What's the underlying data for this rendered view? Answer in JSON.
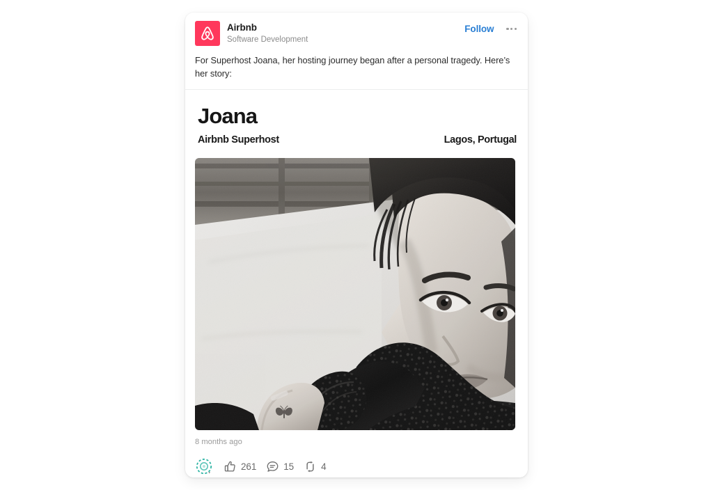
{
  "page": {
    "background_color": "#ffffff"
  },
  "post": {
    "card_background": "#ffffff",
    "header": {
      "logo_icon": "airbnb-belo-logo-icon",
      "logo_color": "#ff385c",
      "brand_name": "Airbnb",
      "brand_subtitle": "Software Development",
      "follow_label": "Follow",
      "follow_color": "#2a7fd4",
      "overflow_icon": "overflow-menu-icon"
    },
    "body_text": "For Superhost Joana, her hosting journey began after a personal tragedy. Here’s her story:",
    "media": {
      "headline": "Joana",
      "role": "Airbnb Superhost",
      "location": "Lagos, Portugal",
      "photo_alt": "Black and white selfie portrait of a woman in a black lace top reclining on a light couch",
      "photo_is_grayscale": true
    },
    "footer": {
      "timestamp": "8 months ago",
      "reaction_picker_icon": "reaction-picker-icon",
      "reaction_picker_color": "#2bb3a3",
      "stats": [
        {
          "icon": "thumbs-up-icon",
          "label": "like",
          "count": "261"
        },
        {
          "icon": "comment-bubble-icon",
          "label": "comment",
          "count": "15"
        },
        {
          "icon": "repost-icon",
          "label": "repost",
          "count": "4"
        }
      ]
    }
  }
}
